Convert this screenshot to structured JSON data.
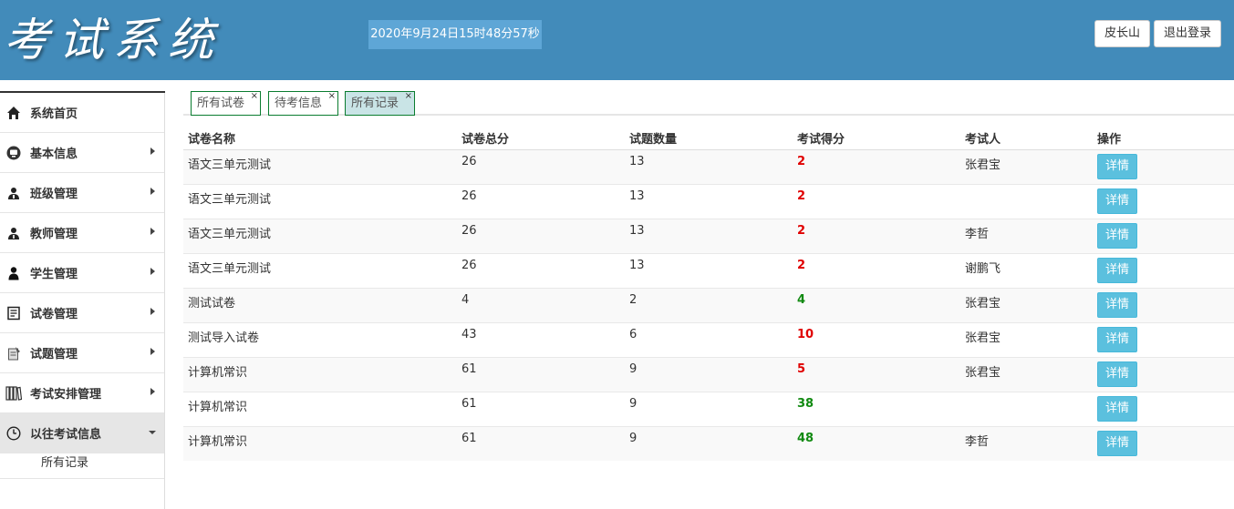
{
  "header": {
    "logo": "考试系统",
    "datetime": "2020年9月24日15时48分57秒",
    "user_button": "皮长山",
    "logout_button": "退出登录"
  },
  "sidebar": {
    "items": [
      {
        "label": "系统首页",
        "icon": "home-icon",
        "has_arrow": false
      },
      {
        "label": "基本信息",
        "icon": "monitor-icon",
        "has_arrow": true
      },
      {
        "label": "班级管理",
        "icon": "users-icon",
        "has_arrow": true
      },
      {
        "label": "教师管理",
        "icon": "teacher-icon",
        "has_arrow": true
      },
      {
        "label": "学生管理",
        "icon": "student-icon",
        "has_arrow": true
      },
      {
        "label": "试卷管理",
        "icon": "paper-icon",
        "has_arrow": true
      },
      {
        "label": "试题管理",
        "icon": "question-icon",
        "has_arrow": true
      },
      {
        "label": "考试安排管理",
        "icon": "books-icon",
        "has_arrow": true
      },
      {
        "label": "以往考试信息",
        "icon": "clock-icon",
        "has_arrow": true,
        "expanded": true
      }
    ],
    "subitem": "所有记录"
  },
  "tabs": [
    {
      "label": "所有试卷",
      "close": "×",
      "active": false
    },
    {
      "label": "待考信息",
      "close": "×",
      "active": false
    },
    {
      "label": "所有记录",
      "close": "×",
      "active": true
    }
  ],
  "table": {
    "columns": [
      "试卷名称",
      "试卷总分",
      "试题数量",
      "考试得分",
      "考试人",
      "操作"
    ],
    "detail_label": "详情",
    "rows": [
      {
        "name": "语文三单元测试",
        "total": "26",
        "count": "13",
        "score": "2",
        "pass": false,
        "examinee": "张君宝"
      },
      {
        "name": "语文三单元测试",
        "total": "26",
        "count": "13",
        "score": "2",
        "pass": false,
        "examinee": ""
      },
      {
        "name": "语文三单元测试",
        "total": "26",
        "count": "13",
        "score": "2",
        "pass": false,
        "examinee": "李哲"
      },
      {
        "name": "语文三单元测试",
        "total": "26",
        "count": "13",
        "score": "2",
        "pass": false,
        "examinee": "谢鹏飞"
      },
      {
        "name": "测试试卷",
        "total": "4",
        "count": "2",
        "score": "4",
        "pass": true,
        "examinee": "张君宝"
      },
      {
        "name": "测试导入试卷",
        "total": "43",
        "count": "6",
        "score": "10",
        "pass": false,
        "examinee": "张君宝"
      },
      {
        "name": "计算机常识",
        "total": "61",
        "count": "9",
        "score": "5",
        "pass": false,
        "examinee": "张君宝"
      },
      {
        "name": "计算机常识",
        "total": "61",
        "count": "9",
        "score": "38",
        "pass": true,
        "examinee": ""
      },
      {
        "name": "计算机常识",
        "total": "61",
        "count": "9",
        "score": "48",
        "pass": true,
        "examinee": "李哲"
      }
    ]
  },
  "colors": {
    "header_bg": "#428bba",
    "score_fail": "#e00000",
    "score_pass": "#118a11",
    "detail_button": "#5bc0de",
    "tab_border": "#0a7c2f"
  }
}
